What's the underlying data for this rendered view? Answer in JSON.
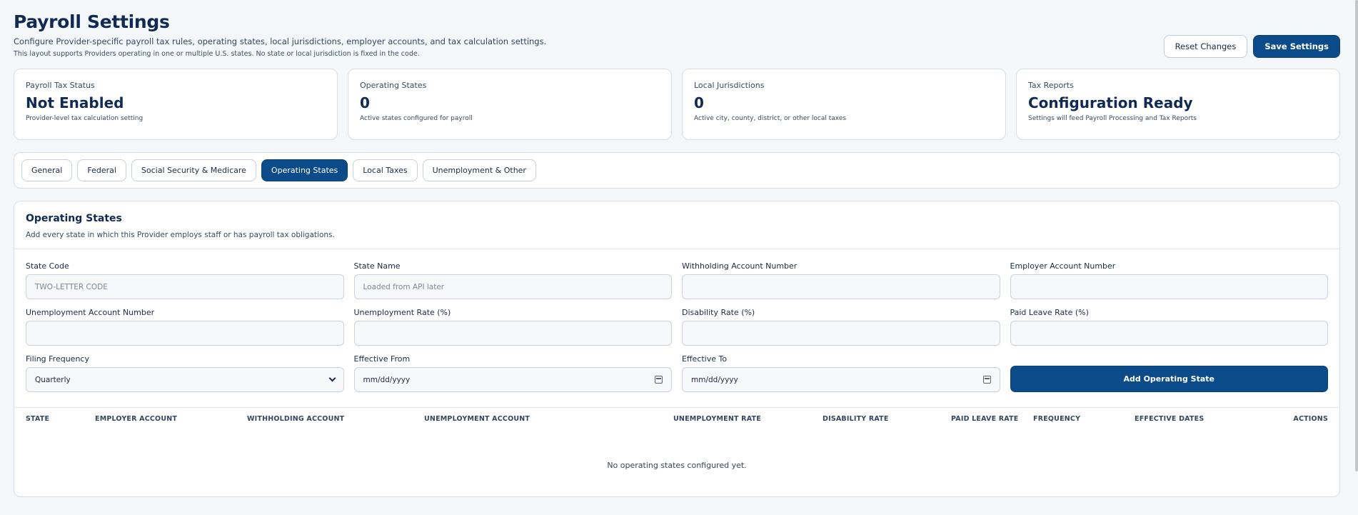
{
  "header": {
    "title": "Payroll Settings",
    "subtitle": "Configure Provider-specific payroll tax rules, operating states, local jurisdictions, employer accounts, and tax calculation settings.",
    "note": "This layout supports Providers operating in one or multiple U.S. states. No state or local jurisdiction is fixed in the code.",
    "reset_label": "Reset Changes",
    "save_label": "Save Settings"
  },
  "stats": [
    {
      "label": "Payroll Tax Status",
      "value": "Not Enabled",
      "desc": "Provider-level tax calculation setting"
    },
    {
      "label": "Operating States",
      "value": "0",
      "desc": "Active states configured for payroll"
    },
    {
      "label": "Local Jurisdictions",
      "value": "0",
      "desc": "Active city, county, district, or other local taxes"
    },
    {
      "label": "Tax Reports",
      "value": "Configuration Ready",
      "desc": "Settings will feed Payroll Processing and Tax Reports"
    }
  ],
  "tabs": [
    {
      "label": "General"
    },
    {
      "label": "Federal"
    },
    {
      "label": "Social Security & Medicare"
    },
    {
      "label": "Operating States",
      "active": true
    },
    {
      "label": "Local Taxes"
    },
    {
      "label": "Unemployment & Other"
    }
  ],
  "panel": {
    "title": "Operating States",
    "desc": "Add every state in which this Provider employs staff or has payroll tax obligations.",
    "fields": {
      "state_code": {
        "label": "State Code",
        "placeholder": "TWO-LETTER CODE"
      },
      "state_name": {
        "label": "State Name",
        "placeholder": "Loaded from API later"
      },
      "withholding": {
        "label": "Withholding Account Number"
      },
      "employer": {
        "label": "Employer Account Number"
      },
      "unemployment_acct": {
        "label": "Unemployment Account Number"
      },
      "unemployment_rate": {
        "label": "Unemployment Rate (%)"
      },
      "disability_rate": {
        "label": "Disability Rate (%)"
      },
      "paid_leave_rate": {
        "label": "Paid Leave Rate (%)"
      },
      "filing_frequency": {
        "label": "Filing Frequency",
        "value": "Quarterly"
      },
      "effective_from": {
        "label": "Effective From",
        "placeholder": "mm/dd/yyyy"
      },
      "effective_to": {
        "label": "Effective To",
        "placeholder": "mm/dd/yyyy"
      }
    },
    "add_label": "Add Operating State"
  },
  "table": {
    "columns": [
      "STATE",
      "EMPLOYER ACCOUNT",
      "WITHHOLDING ACCOUNT",
      "UNEMPLOYMENT ACCOUNT",
      "UNEMPLOYMENT RATE",
      "DISABILITY RATE",
      "PAID LEAVE RATE",
      "FREQUENCY",
      "EFFECTIVE DATES",
      "ACTIONS"
    ],
    "empty": "No operating states configured yet."
  },
  "icons": {
    "date": "calendar-icon",
    "select": "chevron-down-icon"
  },
  "colors": {
    "primary": "#0c4b8a",
    "title": "#102a54"
  }
}
